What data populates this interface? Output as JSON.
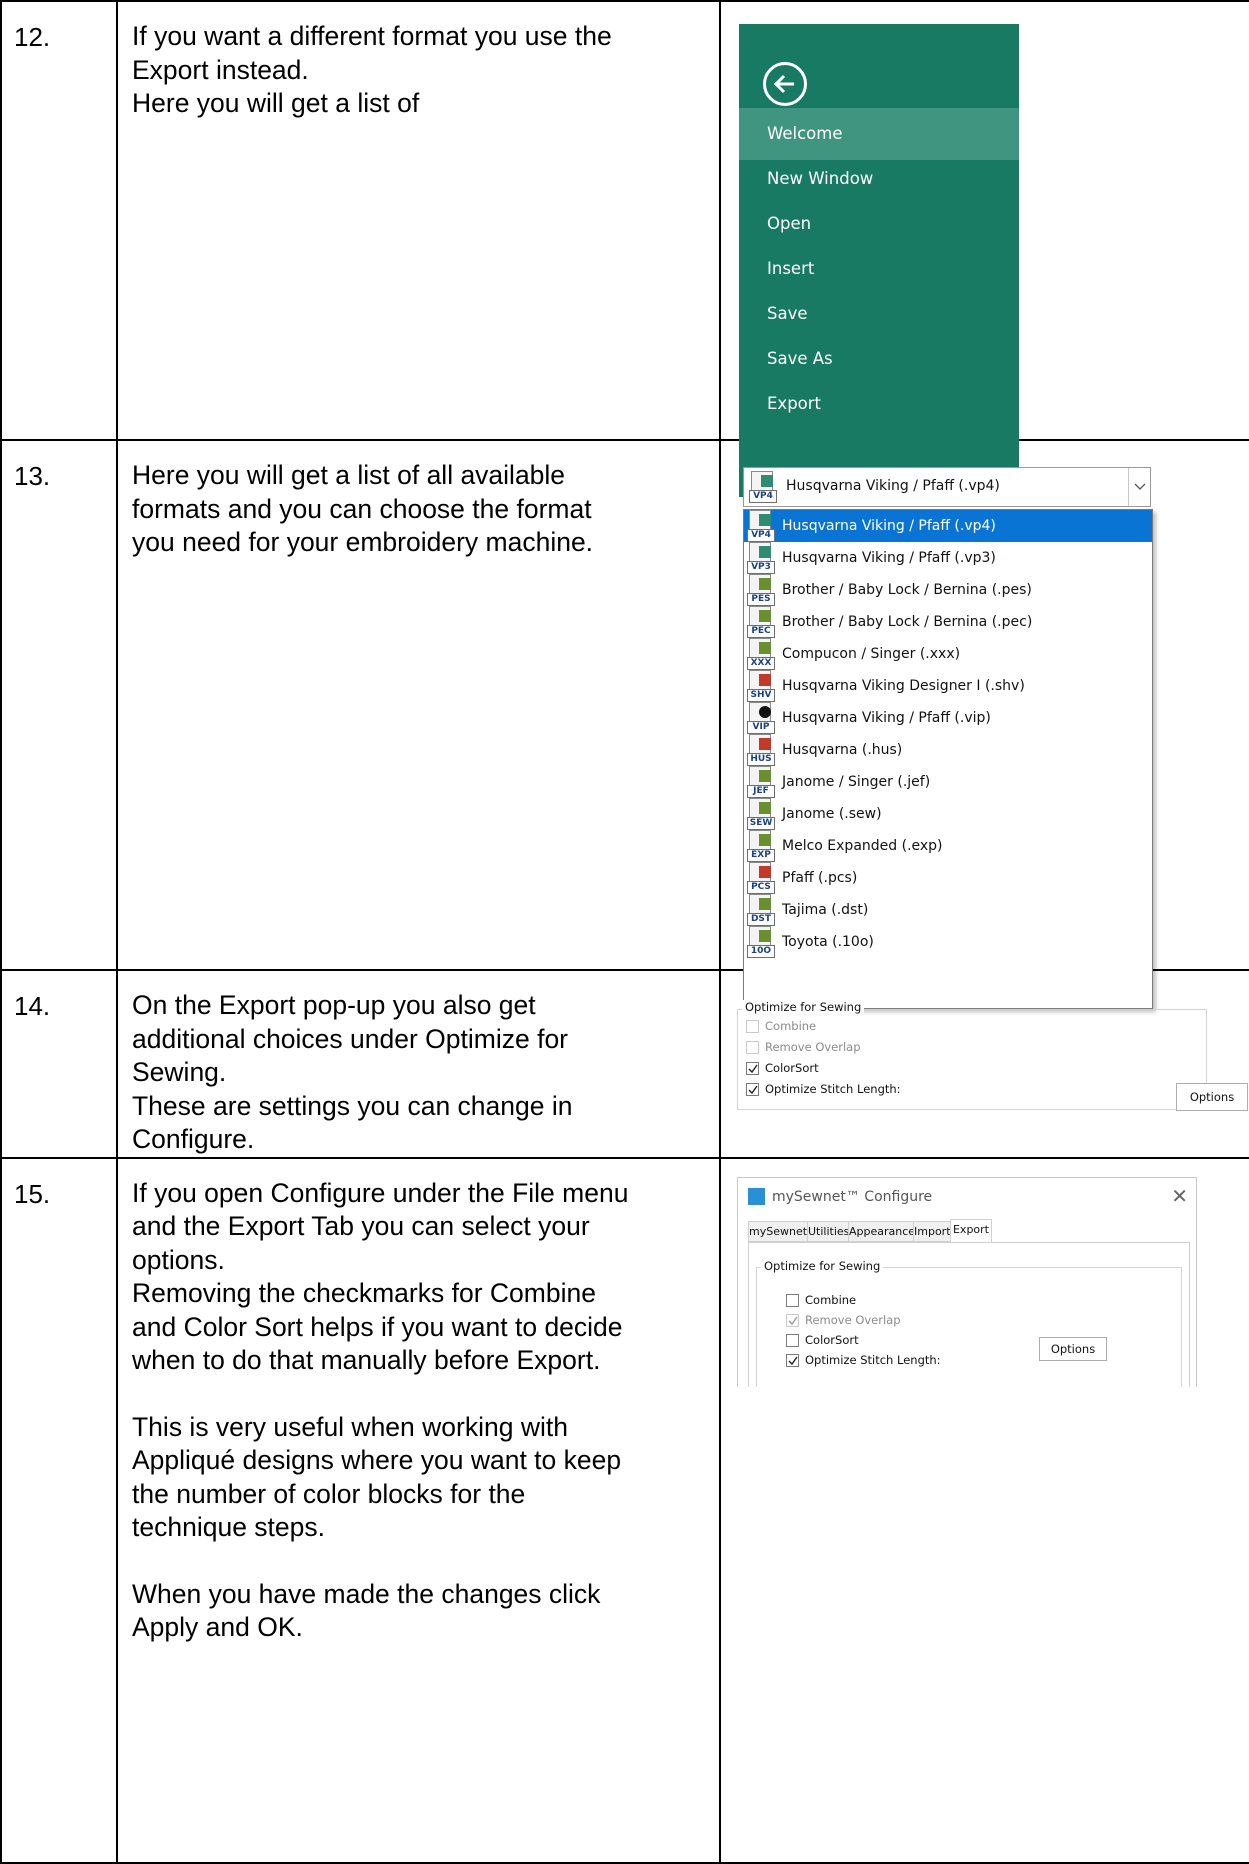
{
  "rows": [
    {
      "num": "12.",
      "lines": [
        "If you want a different format you use the",
        "Export instead.",
        "Here you will get a list of"
      ]
    },
    {
      "num": "13.",
      "lines": [
        "Here you will get a list of all available",
        "formats and you can choose the format",
        "you  need for your embroidery machine."
      ]
    },
    {
      "num": "14.",
      "lines": [
        "On the Export pop-up you also get",
        "additional choices under Optimize for",
        "Sewing.",
        "These are settings you can change in",
        "Configure."
      ]
    },
    {
      "num": "15.",
      "paragraphs": [
        [
          "If you open Configure under the File menu",
          "and the Export Tab you can select your",
          "options.",
          "Removing the checkmarks for Combine",
          "and Color Sort helps if you want to decide",
          "when to do that manually before Export."
        ],
        [
          "This is very useful when working with",
          "Appliqué designs where you want to keep",
          "the number of color blocks for the",
          "technique steps."
        ],
        [
          "When you have made the changes click",
          "Apply and OK."
        ]
      ]
    }
  ],
  "file_menu": {
    "bg_color": "#187a62",
    "active_color": "#3f9580",
    "back_icon": "back-arrow-icon",
    "items": [
      "Welcome",
      "New Window",
      "Open",
      "Insert",
      "Save",
      "Save As",
      "Export"
    ],
    "active_item": "Welcome"
  },
  "format_dropdown": {
    "selected": "Husqvarna Viking / Pfaff (.vp4)",
    "selected_tag": "VP4",
    "highlight_color": "#0a74d4",
    "options": [
      {
        "label": "Husqvarna Viking / Pfaff (.vp4)",
        "tag": "VP4"
      },
      {
        "label": "Husqvarna Viking / Pfaff (.vp3)",
        "tag": "VP3"
      },
      {
        "label": "Brother / Baby Lock / Bernina (.pes)",
        "tag": "PES"
      },
      {
        "label": "Brother / Baby Lock / Bernina (.pec)",
        "tag": "PEC"
      },
      {
        "label": "Compucon / Singer (.xxx)",
        "tag": "XXX"
      },
      {
        "label": "Husqvarna Viking Designer I (.shv)",
        "tag": "SHV"
      },
      {
        "label": "Husqvarna Viking / Pfaff (.vip)",
        "tag": "VIP"
      },
      {
        "label": "Husqvarna (.hus)",
        "tag": "HUS"
      },
      {
        "label": "Janome / Singer (.jef)",
        "tag": "JEF"
      },
      {
        "label": "Janome (.sew)",
        "tag": "SEW"
      },
      {
        "label": "Melco Expanded (.exp)",
        "tag": "EXP"
      },
      {
        "label": "Pfaff (.pcs)",
        "tag": "PCS"
      },
      {
        "label": "Tajima (.dst)",
        "tag": "DST"
      },
      {
        "label": "Toyota (.10o)",
        "tag": "10O"
      }
    ]
  },
  "export_optimize": {
    "title": "Optimize for Sewing",
    "options": [
      {
        "label": "Combine",
        "checked": false,
        "enabled": false
      },
      {
        "label": "Remove Overlap",
        "checked": false,
        "enabled": false
      },
      {
        "label": "ColorSort",
        "checked": true,
        "enabled": true
      },
      {
        "label": "Optimize Stitch Length:",
        "checked": true,
        "enabled": true
      }
    ],
    "button": "Options"
  },
  "configure_window": {
    "title": "mySewnet™ Configure",
    "close_icon": "close-icon",
    "tabs": [
      "mySewnet",
      "Utilities",
      "Appearance",
      "Import",
      "Export"
    ],
    "active_tab": "Export",
    "group_title": "Optimize for Sewing",
    "options": [
      {
        "label": "Combine",
        "checked": false,
        "enabled": true
      },
      {
        "label": "Remove Overlap",
        "checked": true,
        "enabled": false
      },
      {
        "label": "ColorSort",
        "checked": false,
        "enabled": true
      },
      {
        "label": "Optimize Stitch Length:",
        "checked": true,
        "enabled": true
      }
    ],
    "button": "Options"
  }
}
